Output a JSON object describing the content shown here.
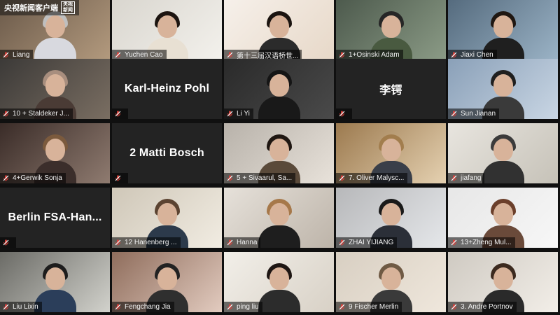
{
  "watermark": {
    "text": "央视新闻客户端",
    "badge": "央视新闻"
  },
  "colors": {
    "active_border": "#c7e23a",
    "mic_muted": "#e0403a"
  },
  "tiles": [
    {
      "label": "Liang",
      "type": "video"
    },
    {
      "label": "Yuchen Cao",
      "type": "video"
    },
    {
      "label": "第十三届汉语桥世...",
      "type": "video"
    },
    {
      "label": "1+Osinski Adam",
      "type": "video"
    },
    {
      "label": "Jiaxi Chen",
      "type": "video"
    },
    {
      "label": "10 + Staldeker J...",
      "type": "video"
    },
    {
      "label": "",
      "type": "name",
      "card_text": "Karl-Heinz Pohl"
    },
    {
      "label": "Li Yi",
      "type": "video",
      "active": true
    },
    {
      "label": "",
      "type": "name",
      "card_text": "李锷"
    },
    {
      "label": "Sun Jianan",
      "type": "video"
    },
    {
      "label": "4+Gerwik Sonja",
      "type": "video"
    },
    {
      "label": "",
      "type": "name",
      "card_text": "2 Matti Bosch"
    },
    {
      "label": "5 + Sivaarul, Sa...",
      "type": "video"
    },
    {
      "label": "7. Oliver Malysc...",
      "type": "video"
    },
    {
      "label": "jiafang",
      "type": "video"
    },
    {
      "label": "",
      "type": "name",
      "card_text": "Berlin  FSA-Han..."
    },
    {
      "label": "12 Hanenberg ...",
      "type": "video"
    },
    {
      "label": "Hanna",
      "type": "video"
    },
    {
      "label": "ZHAI YIJIANG",
      "type": "video"
    },
    {
      "label": "13+Zheng Mul...",
      "type": "video"
    },
    {
      "label": "Liu Lixin",
      "type": "video"
    },
    {
      "label": "Fengchang Jia",
      "type": "video"
    },
    {
      "label": "ping liu",
      "type": "video"
    },
    {
      "label": "9 Fischer Merlin",
      "type": "video"
    },
    {
      "label": "3. Andre Portnov",
      "type": "video"
    }
  ]
}
